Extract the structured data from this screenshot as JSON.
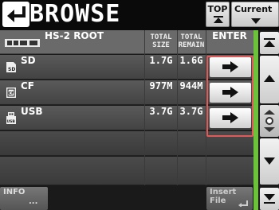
{
  "title_bar": {
    "title": "BROWSE",
    "top_button": "TOP",
    "current_button": "Current"
  },
  "header": {
    "root_label": "HS-2 ROOT",
    "total_size": "TOTAL SIZE",
    "total_remain": "TOTAL REMAIN",
    "enter": "ENTER"
  },
  "rows": [
    {
      "name": "SD",
      "icon": "sd-card-icon",
      "total_size": "1.7G",
      "total_remain": "1.6G"
    },
    {
      "name": "CF",
      "icon": "cf-card-icon",
      "total_size": "977M",
      "total_remain": "944M"
    },
    {
      "name": "USB",
      "icon": "usb-icon",
      "total_size": "3.7G",
      "total_remain": "3.7G"
    }
  ],
  "bottom_bar": {
    "info_label": "INFO",
    "info_more": "...",
    "insert_label": "Insert File"
  },
  "colors": {
    "accent_rail": "#6cc23a",
    "enter_highlight": "#e05a5a"
  }
}
